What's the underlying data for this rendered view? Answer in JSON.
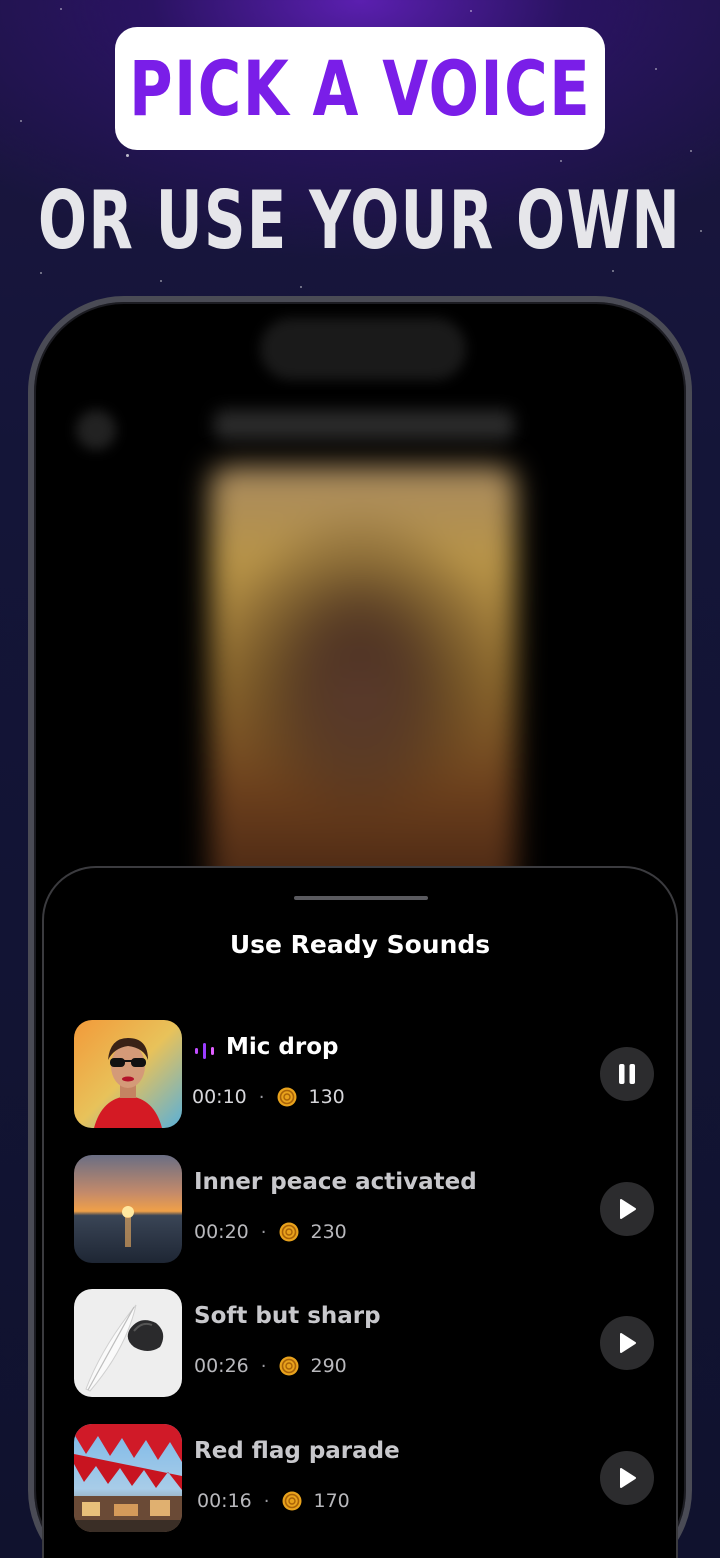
{
  "headline": {
    "pill_text": "PICK A VOICE",
    "subtext": "OR USE YOUR OWN"
  },
  "colors": {
    "accent_purple": "#7a1ee8",
    "background_top": "#5b1fb0",
    "background": "#141538",
    "sheet_bg": "#000000",
    "button_bg": "#2c2c2e",
    "coin": "#e8a21c"
  },
  "sheet": {
    "title": "Use Ready Sounds"
  },
  "sounds": [
    {
      "name": "Mic drop",
      "duration": "00:10",
      "separator": "·",
      "price": "130",
      "state": "playing",
      "icon": "pause-icon",
      "thumbnail": "woman-sunglasses-portrait"
    },
    {
      "name": "Inner peace activated",
      "duration": "00:20",
      "separator": "·",
      "price": "230",
      "state": "paused",
      "icon": "play-icon",
      "thumbnail": "sunset-over-sea"
    },
    {
      "name": "Soft but sharp",
      "duration": "00:26",
      "separator": "·",
      "price": "290",
      "state": "paused",
      "icon": "play-icon",
      "thumbnail": "feather-and-stone"
    },
    {
      "name": "Red flag parade",
      "duration": "00:16",
      "separator": "·",
      "price": "170",
      "state": "paused",
      "icon": "play-icon",
      "thumbnail": "red-flag-bunting-street"
    }
  ]
}
